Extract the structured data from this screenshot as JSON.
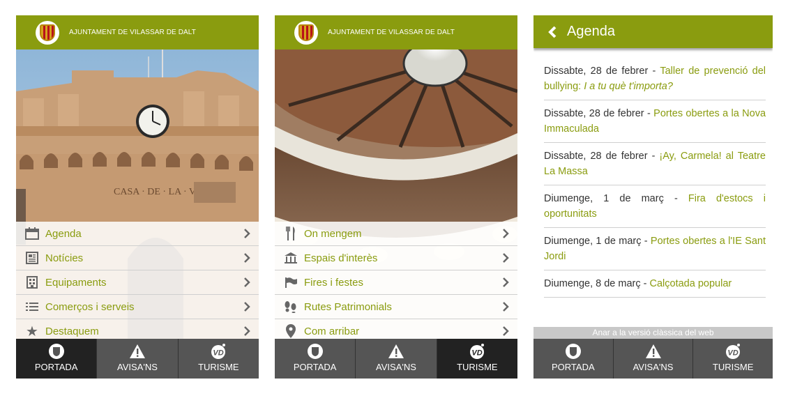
{
  "org_name": "AJUNTAMENT DE VILASSAR DE DALT",
  "home_menu": [
    {
      "label": "Agenda",
      "icon": "calendar-icon"
    },
    {
      "label": "Notícies",
      "icon": "newspaper-icon"
    },
    {
      "label": "Equipaments",
      "icon": "building-icon"
    },
    {
      "label": "Comerços i serveis",
      "icon": "list-icon"
    },
    {
      "label": "Destaquem",
      "icon": "star-icon"
    }
  ],
  "tourism_menu": [
    {
      "label": "On mengem",
      "icon": "fork-knife-icon"
    },
    {
      "label": "Espais d'interès",
      "icon": "landmark-icon"
    },
    {
      "label": "Fires i festes",
      "icon": "flag-icon"
    },
    {
      "label": "Rutes Patrimonials",
      "icon": "footprints-icon"
    },
    {
      "label": "Com arribar",
      "icon": "location-pin-icon"
    }
  ],
  "tabs": [
    {
      "label": "PORTADA",
      "icon": "shield-icon"
    },
    {
      "label": "AVISA'NS",
      "icon": "warning-icon"
    },
    {
      "label": "TURISME",
      "icon": "vd-logo-icon"
    }
  ],
  "agenda": {
    "title": "Agenda",
    "items": [
      {
        "date": "Dissabte, 28 de febrer",
        "sep": " - ",
        "title": "Taller de prevenció del bullying: ",
        "title_em": "I a tu què t'importa?"
      },
      {
        "date": "Dissabte, 28 de febrer",
        "sep": " - ",
        "title": "Portes obertes a la Nova Immaculada",
        "title_em": ""
      },
      {
        "date": "Dissabte, 28 de febrer",
        "sep": " - ",
        "title": "¡Ay, Carmela! al Teatre La Massa",
        "title_em": ""
      },
      {
        "date": "Diumenge, 1 de març",
        "sep": " - ",
        "title": "Fira d'estocs i oportunitats",
        "title_em": ""
      },
      {
        "date": "Diumenge, 1 de març",
        "sep": " - ",
        "title": "Portes obertes a l'IE Sant Jordi",
        "title_em": ""
      },
      {
        "date": "Diumenge, 8 de març",
        "sep": " - ",
        "title": "Calçotada popular",
        "title_em": ""
      }
    ],
    "classic_link": "Anar a la versió clàssica del web"
  },
  "colors": {
    "brand": "#8a9c0f",
    "tab_bg": "#555555",
    "tab_active": "#222222"
  }
}
